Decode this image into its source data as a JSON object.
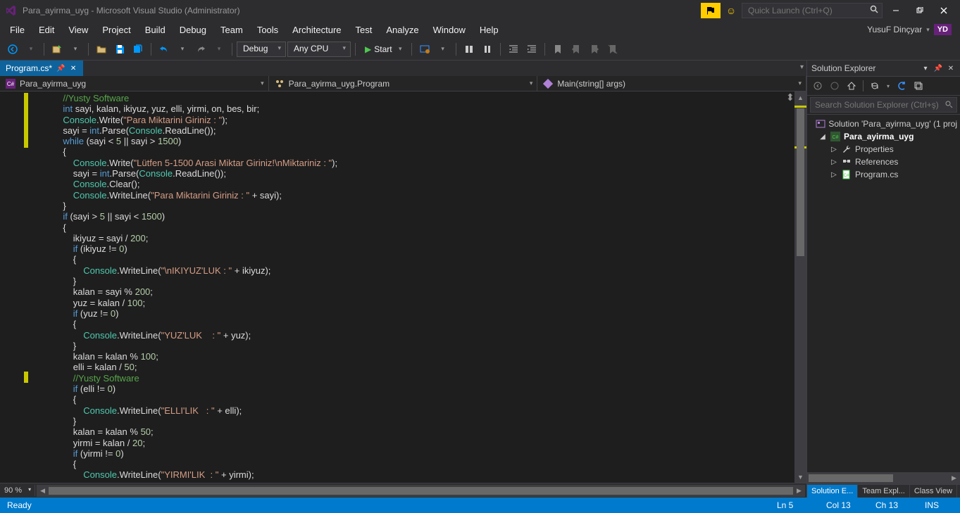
{
  "titlebar": {
    "title": "Para_ayirma_uyg - Microsoft Visual Studio (Administrator)",
    "quick_launch_placeholder": "Quick Launch (Ctrl+Q)"
  },
  "menu": {
    "items": [
      "File",
      "Edit",
      "View",
      "Project",
      "Build",
      "Debug",
      "Team",
      "Tools",
      "Architecture",
      "Test",
      "Analyze",
      "Window",
      "Help"
    ],
    "user_name": "YusuF Dinçyar",
    "user_initials": "YD"
  },
  "toolbar": {
    "config": "Debug",
    "platform": "Any CPU",
    "start": "Start"
  },
  "editor": {
    "tab_name": "Program.cs*",
    "nav1": "Para_ayirma_uyg",
    "nav2": "Para_ayirma_uyg.Program",
    "nav3": "Main(string[] args)",
    "zoom": "90 %",
    "code_lines": [
      {
        "indent": 12,
        "segs": [
          {
            "t": "//Yusty Software",
            "c": "cmt"
          }
        ]
      },
      {
        "indent": 12,
        "segs": [
          {
            "t": "int",
            "c": "kw"
          },
          {
            "t": " sayi, kalan, ikiyuz, yuz, elli, yirmi, on, bes, bir;"
          }
        ]
      },
      {
        "indent": 12,
        "segs": [
          {
            "t": "Console",
            "c": "typ"
          },
          {
            "t": ".Write("
          },
          {
            "t": "\"Para Miktarini Giriniz : \"",
            "c": "str"
          },
          {
            "t": ");"
          }
        ]
      },
      {
        "indent": 12,
        "segs": [
          {
            "t": "sayi = "
          },
          {
            "t": "int",
            "c": "kw"
          },
          {
            "t": ".Parse("
          },
          {
            "t": "Console",
            "c": "typ"
          },
          {
            "t": ".ReadLine());"
          }
        ]
      },
      {
        "indent": 12,
        "segs": [
          {
            "t": "while",
            "c": "kw"
          },
          {
            "t": " (sayi < "
          },
          {
            "t": "5",
            "c": "num"
          },
          {
            "t": " || sayi > "
          },
          {
            "t": "1500",
            "c": "num"
          },
          {
            "t": ")"
          }
        ]
      },
      {
        "indent": 12,
        "segs": [
          {
            "t": "{"
          }
        ]
      },
      {
        "indent": 16,
        "segs": [
          {
            "t": "Console",
            "c": "typ"
          },
          {
            "t": ".Write("
          },
          {
            "t": "\"Lütfen 5-1500 Arasi Miktar Giriniz!\\nMiktariniz : \"",
            "c": "str"
          },
          {
            "t": ");"
          }
        ]
      },
      {
        "indent": 16,
        "segs": [
          {
            "t": "sayi = "
          },
          {
            "t": "int",
            "c": "kw"
          },
          {
            "t": ".Parse("
          },
          {
            "t": "Console",
            "c": "typ"
          },
          {
            "t": ".ReadLine());"
          }
        ]
      },
      {
        "indent": 16,
        "segs": [
          {
            "t": "Console",
            "c": "typ"
          },
          {
            "t": ".Clear();"
          }
        ]
      },
      {
        "indent": 16,
        "segs": [
          {
            "t": "Console",
            "c": "typ"
          },
          {
            "t": ".WriteLine("
          },
          {
            "t": "\"Para Miktarini Giriniz : \"",
            "c": "str"
          },
          {
            "t": " + sayi);"
          }
        ]
      },
      {
        "indent": 12,
        "segs": [
          {
            "t": "}"
          }
        ]
      },
      {
        "indent": 12,
        "segs": [
          {
            "t": "if",
            "c": "kw"
          },
          {
            "t": " (sayi > "
          },
          {
            "t": "5",
            "c": "num"
          },
          {
            "t": " || sayi < "
          },
          {
            "t": "1500",
            "c": "num"
          },
          {
            "t": ")"
          }
        ]
      },
      {
        "indent": 12,
        "segs": [
          {
            "t": "{"
          }
        ]
      },
      {
        "indent": 16,
        "segs": [
          {
            "t": "ikiyuz = sayi / "
          },
          {
            "t": "200",
            "c": "num"
          },
          {
            "t": ";"
          }
        ]
      },
      {
        "indent": 16,
        "segs": [
          {
            "t": "if",
            "c": "kw"
          },
          {
            "t": " (ikiyuz != "
          },
          {
            "t": "0",
            "c": "num"
          },
          {
            "t": ")"
          }
        ]
      },
      {
        "indent": 16,
        "segs": [
          {
            "t": "{"
          }
        ]
      },
      {
        "indent": 20,
        "segs": [
          {
            "t": "Console",
            "c": "typ"
          },
          {
            "t": ".WriteLine("
          },
          {
            "t": "\"\\nIKIYUZ'LUK : \"",
            "c": "str"
          },
          {
            "t": " + ikiyuz);"
          }
        ]
      },
      {
        "indent": 16,
        "segs": [
          {
            "t": "}"
          }
        ]
      },
      {
        "indent": 16,
        "segs": [
          {
            "t": "kalan = sayi % "
          },
          {
            "t": "200",
            "c": "num"
          },
          {
            "t": ";"
          }
        ]
      },
      {
        "indent": 16,
        "segs": [
          {
            "t": "yuz = kalan / "
          },
          {
            "t": "100",
            "c": "num"
          },
          {
            "t": ";"
          }
        ]
      },
      {
        "indent": 16,
        "segs": [
          {
            "t": "if",
            "c": "kw"
          },
          {
            "t": " (yuz != "
          },
          {
            "t": "0",
            "c": "num"
          },
          {
            "t": ")"
          }
        ]
      },
      {
        "indent": 16,
        "segs": [
          {
            "t": "{"
          }
        ]
      },
      {
        "indent": 20,
        "segs": [
          {
            "t": "Console",
            "c": "typ"
          },
          {
            "t": ".WriteLine("
          },
          {
            "t": "\"YUZ'LUK    : \"",
            "c": "str"
          },
          {
            "t": " + yuz);"
          }
        ]
      },
      {
        "indent": 16,
        "segs": [
          {
            "t": "}"
          }
        ]
      },
      {
        "indent": 16,
        "segs": [
          {
            "t": "kalan = kalan % "
          },
          {
            "t": "100",
            "c": "num"
          },
          {
            "t": ";"
          }
        ]
      },
      {
        "indent": 16,
        "segs": [
          {
            "t": "elli = kalan / "
          },
          {
            "t": "50",
            "c": "num"
          },
          {
            "t": ";"
          }
        ]
      },
      {
        "indent": 16,
        "segs": [
          {
            "t": "//Yusty Software",
            "c": "cmt"
          }
        ]
      },
      {
        "indent": 16,
        "segs": [
          {
            "t": "if",
            "c": "kw"
          },
          {
            "t": " (elli != "
          },
          {
            "t": "0",
            "c": "num"
          },
          {
            "t": ")"
          }
        ]
      },
      {
        "indent": 16,
        "segs": [
          {
            "t": "{"
          }
        ]
      },
      {
        "indent": 20,
        "segs": [
          {
            "t": "Console",
            "c": "typ"
          },
          {
            "t": ".WriteLine("
          },
          {
            "t": "\"ELLI'LIK   : \"",
            "c": "str"
          },
          {
            "t": " + elli);"
          }
        ]
      },
      {
        "indent": 16,
        "segs": [
          {
            "t": "}"
          }
        ]
      },
      {
        "indent": 16,
        "segs": [
          {
            "t": "kalan = kalan % "
          },
          {
            "t": "50",
            "c": "num"
          },
          {
            "t": ";"
          }
        ]
      },
      {
        "indent": 16,
        "segs": [
          {
            "t": "yirmi = kalan / "
          },
          {
            "t": "20",
            "c": "num"
          },
          {
            "t": ";"
          }
        ]
      },
      {
        "indent": 16,
        "segs": [
          {
            "t": "if",
            "c": "kw"
          },
          {
            "t": " (yirmi != "
          },
          {
            "t": "0",
            "c": "num"
          },
          {
            "t": ")"
          }
        ]
      },
      {
        "indent": 16,
        "segs": [
          {
            "t": "{"
          }
        ]
      },
      {
        "indent": 20,
        "segs": [
          {
            "t": "Console",
            "c": "typ"
          },
          {
            "t": ".WriteLine("
          },
          {
            "t": "\"YIRMI'LIK  : \"",
            "c": "str"
          },
          {
            "t": " + yirmi);"
          }
        ]
      }
    ]
  },
  "solution_explorer": {
    "title": "Solution Explorer",
    "search_placeholder": "Search Solution Explorer (Ctrl+ş)",
    "solution_label": "Solution 'Para_ayirma_uyg' (1 proj",
    "project": "Para_ayirma_uyg",
    "properties": "Properties",
    "references": "References",
    "program_file": "Program.cs",
    "tabs": [
      "Solution E...",
      "Team Expl...",
      "Class View"
    ]
  },
  "statusbar": {
    "ready": "Ready",
    "ln": "Ln 5",
    "col": "Col 13",
    "ch": "Ch 13",
    "ins": "INS"
  }
}
